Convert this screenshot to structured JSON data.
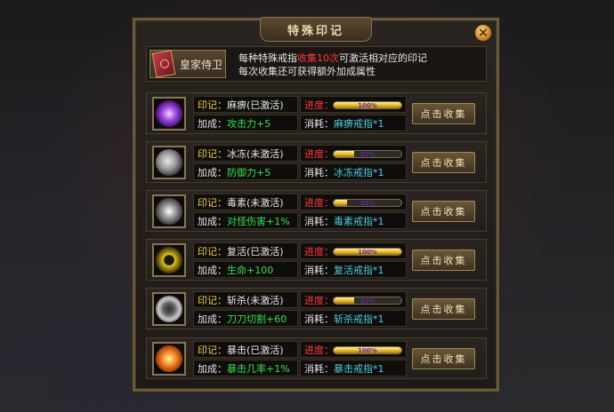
{
  "title": "特殊印记",
  "close_label": "×",
  "header": {
    "badge_label": "皇家侍卫",
    "line1_pre": "每种特殊戒指",
    "line1_hl": "收集10次",
    "line1_post": "可激活相对应的印记",
    "line2": "每次收集还可获得额外加成属性"
  },
  "rows": [
    {
      "mark_prefix": "印记：",
      "mark": "麻痹(已激活)",
      "bonus_prefix": "加成：",
      "bonus": "攻击力+5",
      "progress_prefix": "进度：",
      "progress_text": "100%",
      "progress_value": 1.0,
      "cost_prefix": "消耗：",
      "cost": "麻痹戒指*1",
      "button": "点击收集",
      "icon": "purple-vortex-icon",
      "icon_color": "#a24ce8"
    },
    {
      "mark_prefix": "印记：",
      "mark": "冰冻(未激活)",
      "bonus_prefix": "加成：",
      "bonus": "防御力+5",
      "progress_prefix": "进度：",
      "progress_text": "30%",
      "progress_value": 0.3,
      "cost_prefix": "消耗：",
      "cost": "冰冻戒指*1",
      "button": "点击收集",
      "icon": "grey-swirl-icon",
      "icon_color": "#9a9a9a"
    },
    {
      "mark_prefix": "印记：",
      "mark": "毒素(未激活)",
      "bonus_prefix": "加成：",
      "bonus": "对怪伤害+1%",
      "progress_prefix": "进度：",
      "progress_text": "20%",
      "progress_value": 0.2,
      "cost_prefix": "消耗：",
      "cost": "毒素戒指*1",
      "button": "点击收集",
      "icon": "grey-spiral-icon",
      "icon_color": "#a8a8a8"
    },
    {
      "mark_prefix": "印记：",
      "mark": "复活(已激活)",
      "bonus_prefix": "加成：",
      "bonus": "生命+100",
      "progress_prefix": "进度：",
      "progress_text": "100%",
      "progress_value": 1.0,
      "cost_prefix": "消耗：",
      "cost": "复活戒指*1",
      "button": "点击收集",
      "icon": "gold-rune-icon",
      "icon_color": "#e0c020"
    },
    {
      "mark_prefix": "印记：",
      "mark": "斩杀(未激活)",
      "bonus_prefix": "加成：",
      "bonus": "刀刀切割+60",
      "progress_prefix": "进度：",
      "progress_text": "30%",
      "progress_value": 0.3,
      "cost_prefix": "消耗：",
      "cost": "斩杀戒指*1",
      "button": "点击收集",
      "icon": "silver-ring-icon",
      "icon_color": "#c8c8c8"
    },
    {
      "mark_prefix": "印记：",
      "mark": "暴击(已激活)",
      "bonus_prefix": "加成：",
      "bonus": "暴击几率+1%",
      "progress_prefix": "进度：",
      "progress_text": "100%",
      "progress_value": 1.0,
      "cost_prefix": "消耗：",
      "cost": "暴击戒指*1",
      "button": "点击收集",
      "icon": "orange-flame-orb-icon",
      "icon_color": "#f08020"
    }
  ]
}
